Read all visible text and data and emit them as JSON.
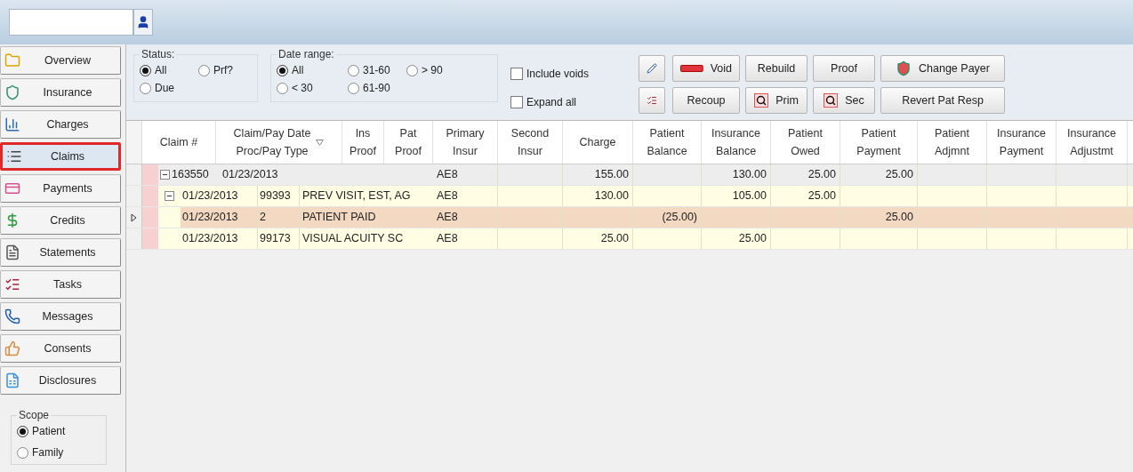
{
  "sidebar": {
    "items": [
      {
        "label": "Overview",
        "selected": false
      },
      {
        "label": "Insurance",
        "selected": false
      },
      {
        "label": "Charges",
        "selected": false
      },
      {
        "label": "Claims",
        "selected": true
      },
      {
        "label": "Payments",
        "selected": false
      },
      {
        "label": "Credits",
        "selected": false
      },
      {
        "label": "Statements",
        "selected": false
      },
      {
        "label": "Tasks",
        "selected": false
      },
      {
        "label": "Messages",
        "selected": false
      },
      {
        "label": "Consents",
        "selected": false
      },
      {
        "label": "Disclosures",
        "selected": false
      }
    ],
    "scope": {
      "title": "Scope",
      "options": [
        {
          "label": "Patient",
          "selected": true
        },
        {
          "label": "Family",
          "selected": false
        }
      ]
    }
  },
  "filters": {
    "status": {
      "title": "Status:",
      "options": [
        {
          "label": "All",
          "selected": true
        },
        {
          "label": "Prf?",
          "selected": false
        },
        {
          "label": "Due",
          "selected": false
        }
      ]
    },
    "date_range": {
      "title": "Date range:",
      "options": [
        {
          "label": "All",
          "selected": true
        },
        {
          "label": "31-60",
          "selected": false
        },
        {
          "label": "> 90",
          "selected": false
        },
        {
          "label": "< 30",
          "selected": false
        },
        {
          "label": "61-90",
          "selected": false
        }
      ]
    },
    "checkboxes": [
      {
        "label": "Include voids",
        "checked": false
      },
      {
        "label": "Expand all",
        "checked": false
      }
    ]
  },
  "toolbar": {
    "buttons": [
      {
        "label": "Void"
      },
      {
        "label": "Recoup"
      },
      {
        "label": "Rebuild"
      },
      {
        "label": "Prim"
      },
      {
        "label": "Proof"
      },
      {
        "label": "Sec"
      },
      {
        "label": "Change Payer"
      },
      {
        "label": "Revert Pat Resp"
      }
    ]
  },
  "table": {
    "columns": [
      {
        "label": "Claim #",
        "sorted": false
      },
      {
        "label": "Claim/Pay Date\nProc/Pay Type",
        "sorted": true
      },
      {
        "label": "Ins\nProof",
        "sorted": false
      },
      {
        "label": "Pat\nProof",
        "sorted": false
      },
      {
        "label": "Primary\nInsur",
        "sorted": false
      },
      {
        "label": "Second\nInsur",
        "sorted": false
      },
      {
        "label": "Charge",
        "sorted": false
      },
      {
        "label": "Patient\nBalance",
        "sorted": false
      },
      {
        "label": "Insurance\nBalance",
        "sorted": false
      },
      {
        "label": "Patient\nOwed",
        "sorted": false
      },
      {
        "label": "Patient\nPayment",
        "sorted": false
      },
      {
        "label": "Patient\nAdjmnt",
        "sorted": false
      },
      {
        "label": "Insurance\nPayment",
        "sorted": false
      },
      {
        "label": "Insurance\nAdjustmt",
        "sorted": false
      }
    ],
    "rows": [
      {
        "kind": "claim",
        "expanded": true,
        "current": false,
        "cells": [
          "163550",
          "01/23/2013",
          null,
          null,
          "AE8",
          null,
          "155.00",
          null,
          "130.00",
          "25.00",
          "25.00",
          null,
          null,
          null
        ],
        "children": [
          {
            "kind": "procedure",
            "expanded": true,
            "current": false,
            "cells": [
              "01/23/2013",
              "99393",
              "PREV VISIT, EST, AG",
              null,
              "AE8",
              null,
              "130.00",
              null,
              "105.00",
              "25.00",
              null,
              null,
              null,
              null
            ],
            "children": [
              {
                "kind": "payment",
                "current": true,
                "cells": [
                  "01/23/2013",
                  "2",
                  "PATIENT PAID",
                  null,
                  "AE8",
                  null,
                  null,
                  "(25.00)",
                  null,
                  null,
                  "25.00",
                  null,
                  null,
                  null
                ]
              }
            ]
          },
          {
            "kind": "procedure",
            "current": false,
            "cells": [
              "01/23/2013",
              "99173",
              "VISUAL ACUITY SC",
              null,
              "AE8",
              null,
              "25.00",
              null,
              "25.00",
              null,
              null,
              null,
              null,
              null
            ]
          }
        ]
      }
    ]
  }
}
